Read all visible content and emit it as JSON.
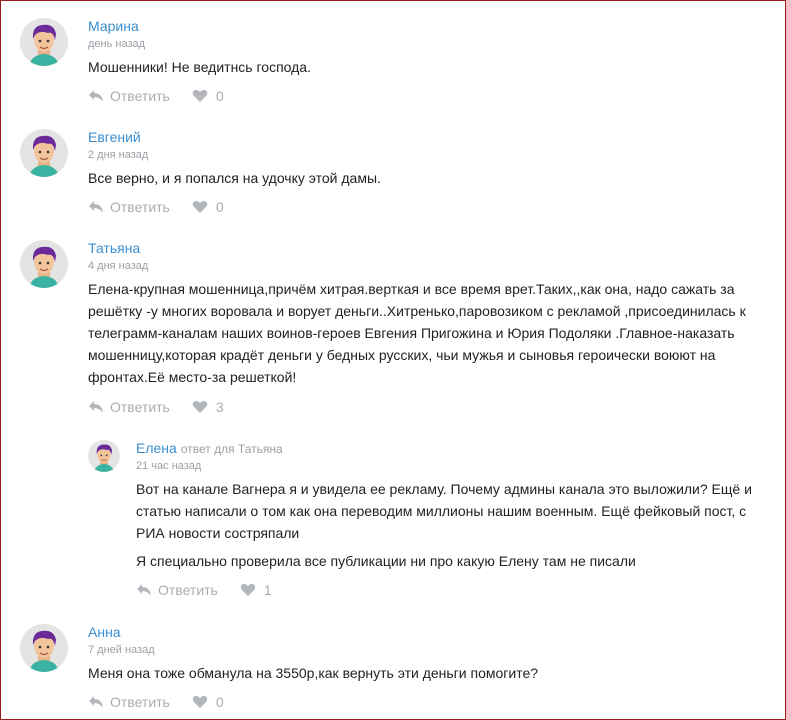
{
  "colors": {
    "accent": "#3a8fd0",
    "muted": "#9aa0a6",
    "border": "#9b1b1b"
  },
  "icons": {
    "reply": "reply-arrow-icon",
    "like": "heart-icon",
    "avatar": "user-avatar-icon"
  },
  "comments": [
    {
      "author": "Марина",
      "time": "день назад",
      "text": [
        "Мошенники! Не ведитнсь господа."
      ],
      "reply_label": "Ответить",
      "likes": "0"
    },
    {
      "author": "Евгений",
      "time": "2 дня назад",
      "text": [
        "Все верно, и я попался на удочку этой дамы."
      ],
      "reply_label": "Ответить",
      "likes": "0"
    },
    {
      "author": "Татьяна",
      "time": "4 дня назад",
      "text": [
        "Елена-крупная мошенница,причём хитрая.верткая и все время врет.Таких,,как она, надо сажать за решётку -у многих воровала и ворует деньги..Хитренько,паровозиком с рекламой ,присоединилась к телеграмм-каналам наших воинов-героев Евгения Пригожина и Юрия Подоляки .Главное-наказать мошенницу,которая крадёт деньги у бедных русских, чьи мужья и сыновья героически воюют на фронтах.Её место-за решеткой!"
      ],
      "reply_label": "Ответить",
      "likes": "3"
    },
    {
      "author": "Елена",
      "reply_to": "ответ для Татьяна",
      "time": "21 час назад",
      "text": [
        "Вот на канале Вагнера я и увидела ее рекламу. Почему админы канала это выложили? Ещё и статью написали о том как она переводим миллионы нашим военным. Ещё фейковый пост, с РИА новости состряпали",
        "Я специально проверила все публикации ни про какую Елену там не писали"
      ],
      "reply_label": "Ответить",
      "likes": "1"
    },
    {
      "author": "Анна",
      "time": "7 дней назад",
      "text": [
        "Меня она тоже обманула на 3550р,как вернуть эти деньги помогите?"
      ],
      "reply_label": "Ответить",
      "likes": "0"
    }
  ]
}
